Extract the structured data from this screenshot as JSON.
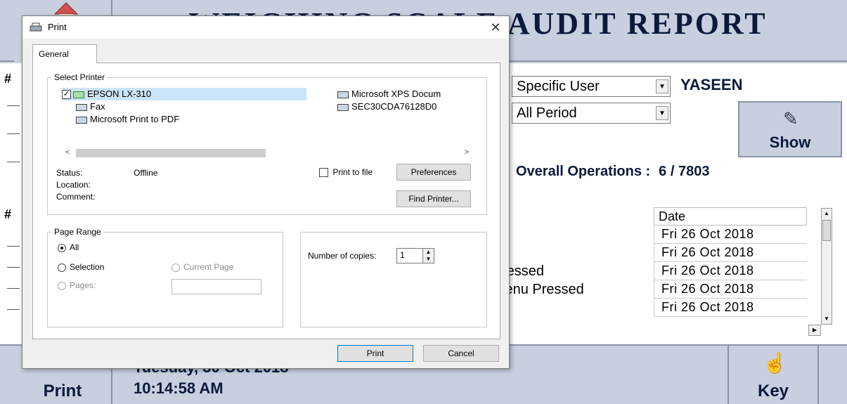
{
  "app": {
    "title": "WEIGHING SCALE AUDIT REPORT",
    "filters": {
      "user_mode": "Specific User",
      "period": "All Period",
      "user_name": "YASEEN"
    },
    "show_label": "Show",
    "operations_label": "Overall Operations :",
    "operations_value": "6 / 7803",
    "row_marker": "#",
    "grid": {
      "date_header": "Date",
      "rows": [
        {
          "desc": "",
          "date": "Fri 26 Oct 2018"
        },
        {
          "desc": "",
          "date": "Fri 26 Oct 2018"
        },
        {
          "desc": "ressed",
          "date": "Fri 26 Oct 2018"
        },
        {
          "desc": "lenu Pressed",
          "date": "Fri 26 Oct 2018"
        },
        {
          "desc": "",
          "date": "Fri 26 Oct 2018"
        }
      ]
    },
    "footer": {
      "print_label": "Print",
      "date": "Tuesday, 30 Oct 2018",
      "time": "10:14:58 AM",
      "key_label": "Key"
    }
  },
  "dialog": {
    "title": "Print",
    "close_glyph": "✕",
    "tab": "General",
    "select_printer_label": "Select Printer",
    "printers": [
      {
        "name": "EPSON LX-310",
        "selected": true
      },
      {
        "name": "Fax"
      },
      {
        "name": "Microsoft Print to PDF"
      },
      {
        "name": "Microsoft XPS Docum"
      },
      {
        "name": "SEC30CDA76128D0"
      }
    ],
    "scroll_left": "<",
    "scroll_right": ">",
    "status_label": "Status:",
    "status_value": "Offline",
    "location_label": "Location:",
    "comment_label": "Comment:",
    "print_to_file": "Print to file",
    "preferences": "Preferences",
    "find_printer": "Find Printer...",
    "page_range_label": "Page Range",
    "range_all": "All",
    "range_selection": "Selection",
    "range_current": "Current Page",
    "range_pages": "Pages:",
    "copies_label": "Number of copies:",
    "copies_value": "1",
    "print_button": "Print",
    "cancel_button": "Cancel"
  }
}
